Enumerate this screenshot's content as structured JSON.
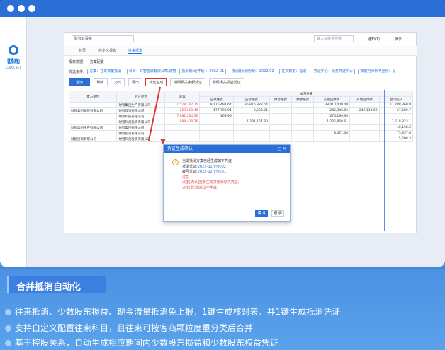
{
  "logo": {
    "name": "财咖",
    "sub": "CAIKA.NET"
  },
  "topbar": {
    "select": "财智云投资",
    "search_placeholder": "输入关键字搜索",
    "notice": "通知(1)",
    "user": "演示"
  },
  "tabs": [
    {
      "label": "首页"
    },
    {
      "label": "自定义报表"
    },
    {
      "label": "往来抵消"
    }
  ],
  "subtabs": [
    "报表数据",
    "方案配置"
  ],
  "conditions": {
    "label": "筛选条件:",
    "items": [
      "方案：往来数据抵消",
      "科目：财智金融有限公司,财智金融有限公司...",
      "抵消期间(开始)：2022-01",
      "抵消期间(结束)：2022-02",
      "往来数据：提取",
      "凭证中心：批量凭证中心",
      "数据与分析不显示：是"
    ]
  },
  "buttons": {
    "query": "查询",
    "print": "刷新",
    "save": "万元",
    "export": "导出",
    "gen": "凭证生成",
    "b6": "期间相关余额凭证",
    "b7": "期间相关损益凭证"
  },
  "table": {
    "group_header": "本方往来",
    "headers": [
      "本方单位",
      "对方单位",
      "差异",
      "应收账款",
      "应付账款",
      "预付账款",
      "预收账款",
      "其他应收款",
      "其他应付款",
      "合同资产"
    ],
    "rows": [
      {
        "a": "",
        "b": "财智集团生产有限公司",
        "c": "-1,578,247.75",
        "d": "9,176,491.64",
        "e": "35,876,923.64",
        "f": "",
        "g": "",
        "h": "38,410,400.00",
        "i": "",
        "j": "11,788,360.0"
      },
      {
        "a": "财智集团销售有限公司",
        "b": "财智投资有限公司",
        "c": "-253,519.46",
        "d": "177,798.91",
        "e": "9,588.21",
        "f": "",
        "g": "",
        "h": "-245,346.06",
        "i": "249,114.60",
        "j": "27,689.7"
      },
      {
        "a": "",
        "b": "财智科技有限公司",
        "c": "7,081,204.32",
        "d": "163.96",
        "e": "",
        "f": "",
        "g": "",
        "h": "276,190.36",
        "i": "",
        "j": ""
      },
      {
        "a": "",
        "b": "财智科创投资有限公司",
        "c": "898,430.26",
        "d": "",
        "e": "1,291,167.80",
        "f": "",
        "g": "",
        "h": "1,225,868.61",
        "i": "",
        "j": "1,518,823.1"
      },
      {
        "a": "财智集团生产有限公司",
        "b": "财智集团有限公司",
        "c": "",
        "d": "",
        "e": "",
        "f": "",
        "g": "",
        "h": "",
        "i": "",
        "j": "40,168.2"
      },
      {
        "a": "",
        "b": "财智投资有限公司",
        "c": "",
        "d": "",
        "e": "",
        "f": "",
        "g": "",
        "h": "8,471.00",
        "i": "",
        "j": "73,357.6"
      },
      {
        "a": "财智投资有限公司",
        "b": "财智科创投资有限公司",
        "c": "",
        "d": "",
        "e": "",
        "f": "",
        "g": "",
        "h": "",
        "i": "",
        "j": "5,298.3"
      }
    ]
  },
  "dialog": {
    "title": "凭证生成确认",
    "line1": "当期抵消方案已经生成如下凭证:",
    "line2a": "抵消凭证:",
    "line2b": "2022-01:记0002",
    "line3a": "转回凭证:",
    "line3b": "2022-02:记0001",
    "note": "注意",
    "warn1": "点击[确认]重新生成并删除原先凭证,",
    "warn2": "点击[取消]退出不生成。",
    "ok": "确 认",
    "cancel": "取 消"
  },
  "section": {
    "title": "合并抵消自动化"
  },
  "bullets": [
    "往来抵消、少数股东损益、现金流量抵消免上报，1键生成核对表，并1键生成抵消凭证",
    "支持自定义配置往来科目，且往来可按客商颗粒度重分类后合并",
    "基于控股关系，自动生成相应期间内少数股东损益和少数股东权益凭证"
  ]
}
